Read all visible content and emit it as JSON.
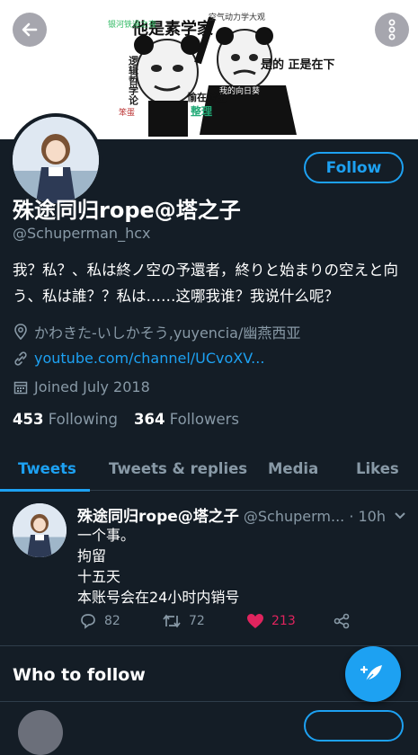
{
  "colors": {
    "accent": "#1da1f2",
    "background": "#141d26",
    "secondary_text": "#8899a6",
    "like": "#e0245e"
  },
  "banner": {
    "caption_left": "他是素学家",
    "caption_right": "是的 正是在下",
    "labels": [
      "逻辑哲学论",
      "空气动力学大观",
      "银河铁道之夜",
      "我的向日葵",
      "愉在转生",
      "整理",
      "笨蛋"
    ]
  },
  "profile": {
    "name": "殊途同归rope@塔之子",
    "handle": "@Schuperman_hcx",
    "bio": "我？私？、私は終ノ空の予還者，終りと始まりの空えと向う、私は誰？？私は……这哪我谁？我说什么呢？",
    "location": "かわきた-いしかそう,yuyencia/幽燕西亚",
    "link": "youtube.com/channel/UCvoXV...",
    "joined": "Joined July 2018",
    "following_count": "453",
    "following_label": "Following",
    "followers_count": "364",
    "followers_label": "Followers",
    "follow_button": "Follow"
  },
  "tabs": [
    "Tweets",
    "Tweets & replies",
    "Media",
    "Likes"
  ],
  "tweet": {
    "name": "殊途同归rope@塔之子",
    "handle": "@Schuperm...",
    "time": "· 10h",
    "lines": [
      "一个事。",
      "拘留",
      "十五天",
      "本账号会在24小时内销号"
    ],
    "replies": "82",
    "retweets": "72",
    "likes": "213"
  },
  "who_to_follow": "Who to follow",
  "icons": [
    "back-arrow-icon",
    "more-vertical-icon",
    "location-pin-icon",
    "link-icon",
    "calendar-icon",
    "reply-icon",
    "retweet-icon",
    "heart-icon",
    "share-icon",
    "compose-icon",
    "chevron-down-icon"
  ]
}
